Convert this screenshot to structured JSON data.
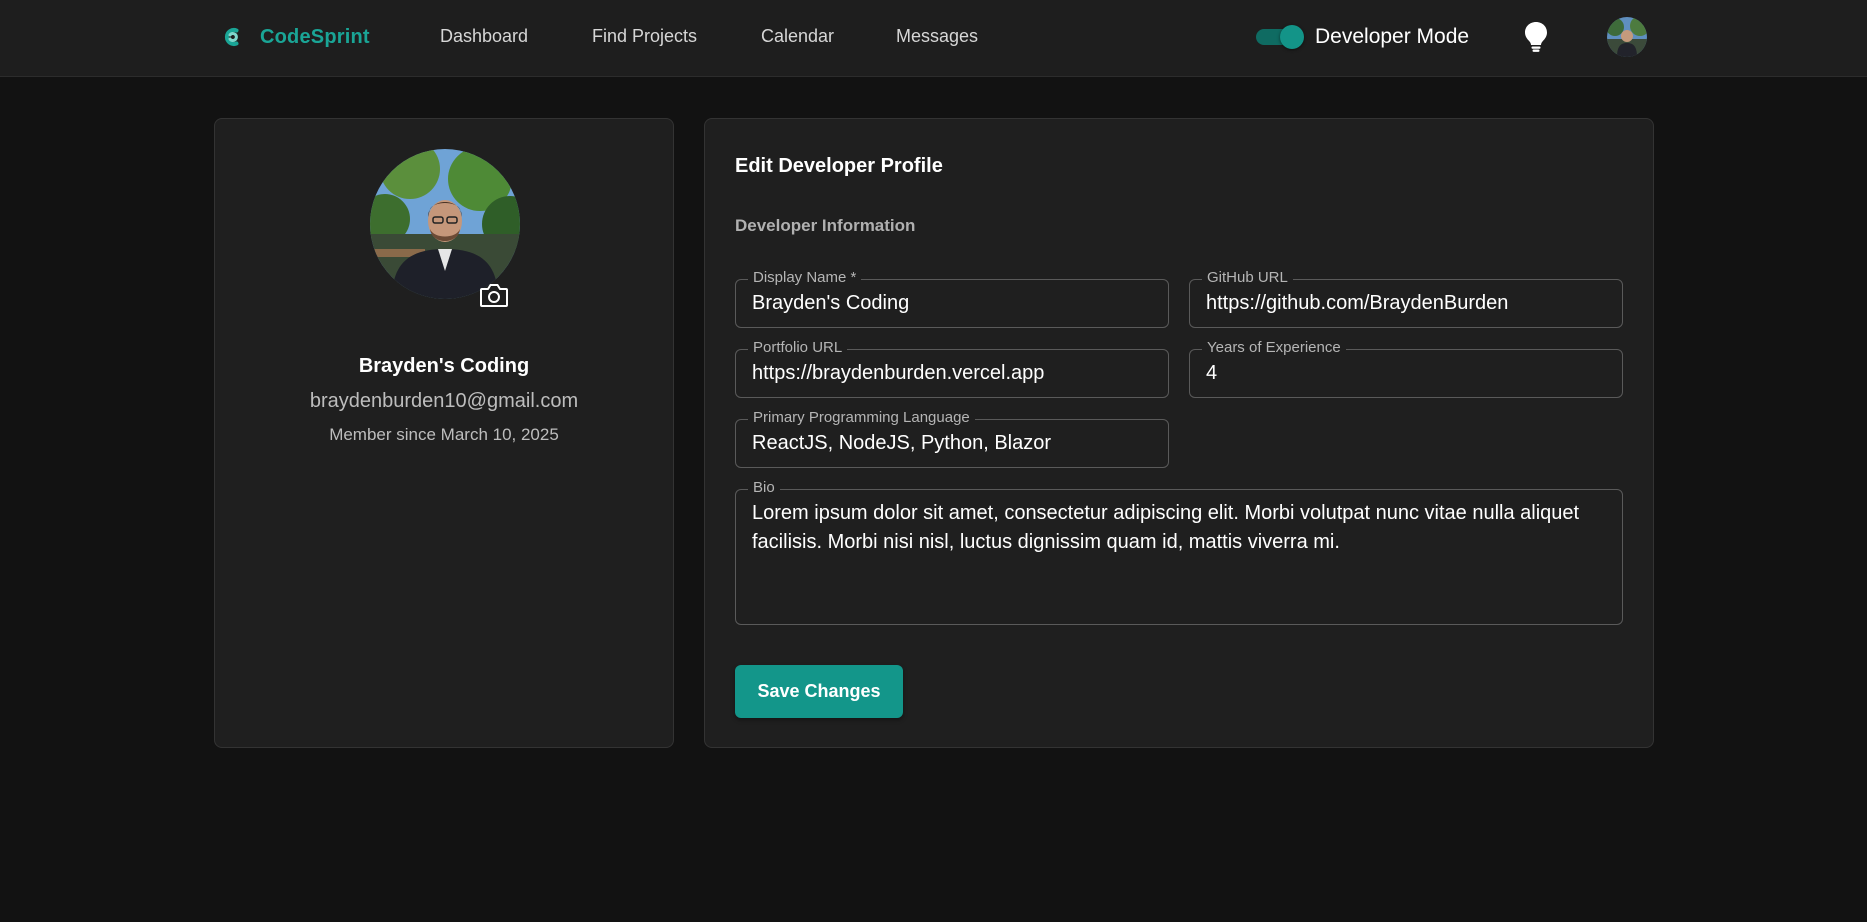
{
  "header": {
    "brand_name": "CodeSprint",
    "brand_icon": "codesprint-logo-icon",
    "nav": [
      {
        "label": "Dashboard"
      },
      {
        "label": "Find Projects"
      },
      {
        "label": "Calendar"
      },
      {
        "label": "Messages"
      }
    ],
    "mode_toggle": {
      "label": "Developer Mode",
      "on": true
    },
    "theme_icon": "lightbulb-icon",
    "avatar_icon": "user-avatar"
  },
  "profile_card": {
    "name": "Brayden's Coding",
    "email": "braydenburden10@gmail.com",
    "member_since": "Member since March 10, 2025",
    "camera_icon": "camera-icon"
  },
  "form": {
    "title": "Edit Developer Profile",
    "section": "Developer Information",
    "fields": {
      "display_name": {
        "label": "Display Name *",
        "value": "Brayden's Coding"
      },
      "github_url": {
        "label": "GitHub URL",
        "value": "https://github.com/BraydenBurden"
      },
      "portfolio_url": {
        "label": "Portfolio URL",
        "value": "https://braydenburden.vercel.app"
      },
      "years_experience": {
        "label": "Years of Experience",
        "value": "4"
      },
      "primary_language": {
        "label": "Primary Programming Language",
        "value": "ReactJS, NodeJS, Python, Blazor"
      },
      "bio": {
        "label": "Bio",
        "value": "Lorem ipsum dolor sit amet, consectetur adipiscing elit. Morbi volutpat nunc vitae nulla aliquet facilisis. Morbi nisi nisl, luctus dignissim quam id, mattis viverra mi."
      }
    },
    "save_label": "Save Changes"
  },
  "colors": {
    "accent": "#13968a",
    "brand": "#1aa596",
    "background": "#121212",
    "card": "#1f1f1f",
    "topbar": "#1e1e1e"
  }
}
